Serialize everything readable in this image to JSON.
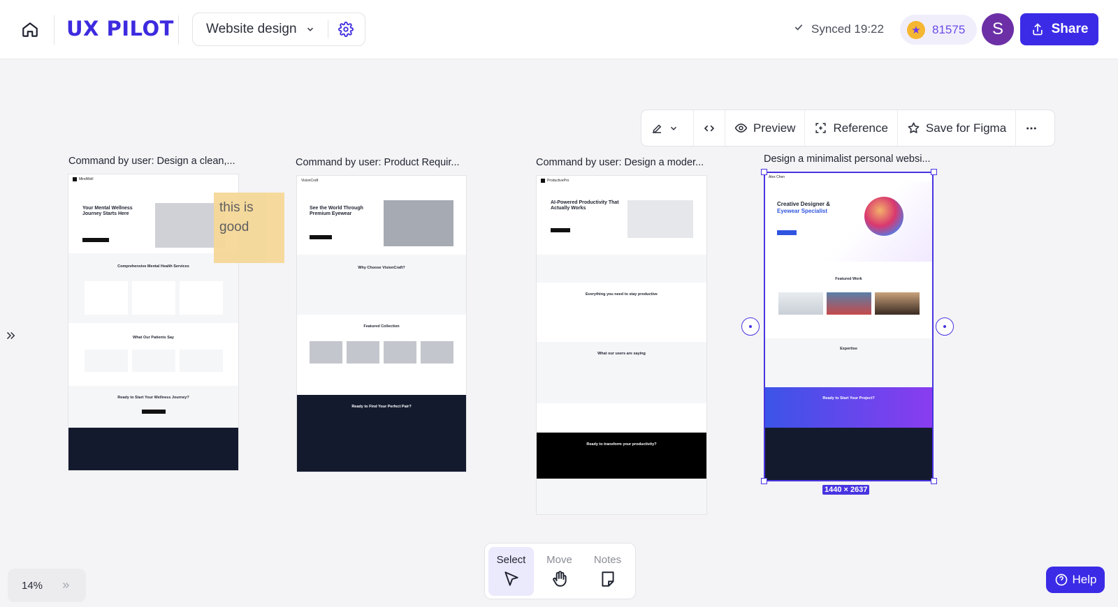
{
  "header": {
    "logo_text": "UX PILOT",
    "project_name": "Website design",
    "sync_status": "Synced 19:22",
    "credits": "81575",
    "avatar_initial": "S",
    "share_label": "Share"
  },
  "frame_toolbar": {
    "preview_label": "Preview",
    "reference_label": "Reference",
    "save_figma_label": "Save for Figma"
  },
  "frames": [
    {
      "title": "Command by user: Design a clean,...",
      "brand": "MindWell",
      "hero_title": "Your Mental Wellness Journey Starts Here",
      "section1": "Comprehensive Mental Health Services",
      "section2": "What Our Patients Say",
      "cta": "Ready to Start Your Wellness Journey?"
    },
    {
      "title": "Command by user: Product Requir...",
      "brand": "VisionCraft",
      "hero_title": "See the World Through Premium Eyewear",
      "section1": "Why Choose VisionCraft?",
      "section2": "Featured Collection",
      "cta": "Ready to Find Your Perfect Pair?"
    },
    {
      "title": "Command by user: Design a moder...",
      "brand": "ProductivePro",
      "hero_title": "AI-Powered Productivity That Actually Works",
      "section1": "Everything you need to stay productive",
      "section2": "What our users are saying",
      "cta": "Ready to transform your productivity?"
    },
    {
      "title": "Design a minimalist personal websi...",
      "brand": "Alex Chen",
      "hero_title": "Creative Designer &",
      "hero_accent": "Eyewear Specialist",
      "section1": "Featured Work",
      "section2": "Expertise",
      "cta": "Ready to Start Your Project?"
    }
  ],
  "sticky_note": "this is good",
  "selection_dims": "1440 × 2637",
  "zoom_level": "14%",
  "modes": [
    {
      "label": "Select",
      "icon": "cursor-icon",
      "active": true
    },
    {
      "label": "Move",
      "icon": "hand-icon",
      "active": false
    },
    {
      "label": "Notes",
      "icon": "note-icon",
      "active": false
    }
  ],
  "help_label": "Help",
  "colors": {
    "brand": "#3d2bdf",
    "selection": "#4834e0",
    "sticky": "#f5d898"
  }
}
